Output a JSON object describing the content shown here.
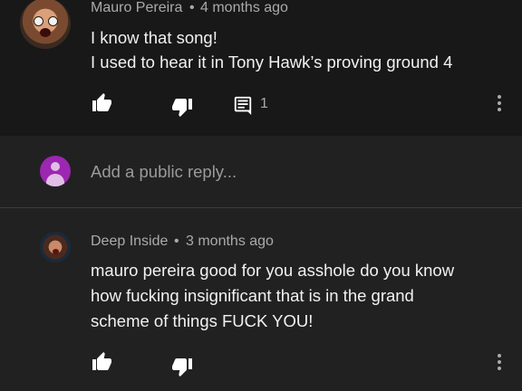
{
  "comments": [
    {
      "author": "Mauro Pereira",
      "separator": "•",
      "time": "4 months ago",
      "lines": [
        "I know that song!",
        "I used to hear it in Tony Hawk’s proving ground 4"
      ],
      "reply_count": "1"
    },
    {
      "author": "Deep Inside",
      "separator": "•",
      "time": "3 months ago",
      "lines": [
        "mauro pereira good for you asshole do you know",
        "how fucking insignificant that is in the grand",
        "scheme of things FUCK YOU!"
      ]
    }
  ],
  "reply_box": {
    "placeholder": "Add a public reply..."
  },
  "icons": {
    "like": "thumb-up-icon",
    "dislike": "thumb-down-icon",
    "reply": "comment-icon",
    "more": "more-vert-icon"
  },
  "colors": {
    "background": "#181818",
    "reply_area": "#212121",
    "user_avatar": "#9c27b0",
    "text_primary": "#f1f1f1",
    "text_secondary": "#aaaaaa"
  }
}
